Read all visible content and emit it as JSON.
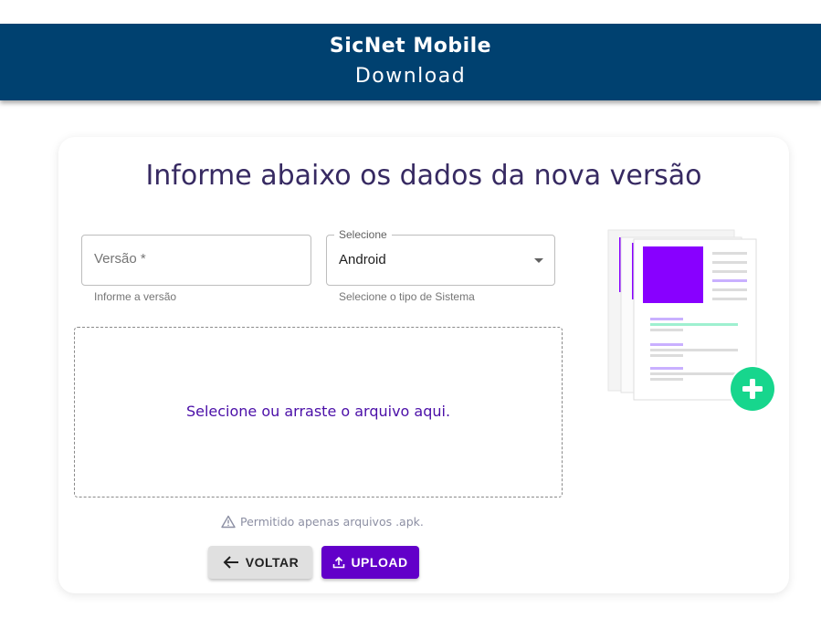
{
  "header": {
    "app_name": "SicNet Mobile",
    "page_name": "Download",
    "background_color": "#004170"
  },
  "card": {
    "title": "Informe abaixo os dados da nova versão"
  },
  "form": {
    "version_field": {
      "placeholder": "Versão *",
      "value": "",
      "helper": "Informe a versão"
    },
    "system_select": {
      "label": "Selecione",
      "selected": "Android",
      "helper": "Selecione o tipo de Sistema"
    },
    "dropzone": {
      "text": "Selecione ou arraste o arquivo aqui."
    },
    "notice": {
      "icon": "warning-triangle-icon",
      "text": "Permitido apenas arquivos .apk."
    }
  },
  "buttons": {
    "back": {
      "label": "VOLTAR",
      "icon": "arrow-left-icon"
    },
    "upload": {
      "label": "UPLOAD",
      "icon": "upload-icon",
      "color": "#6200c9"
    }
  },
  "illustration": {
    "icon": "add-document-icon",
    "accent_color": "#8800ff",
    "add_color": "#17d68d"
  }
}
